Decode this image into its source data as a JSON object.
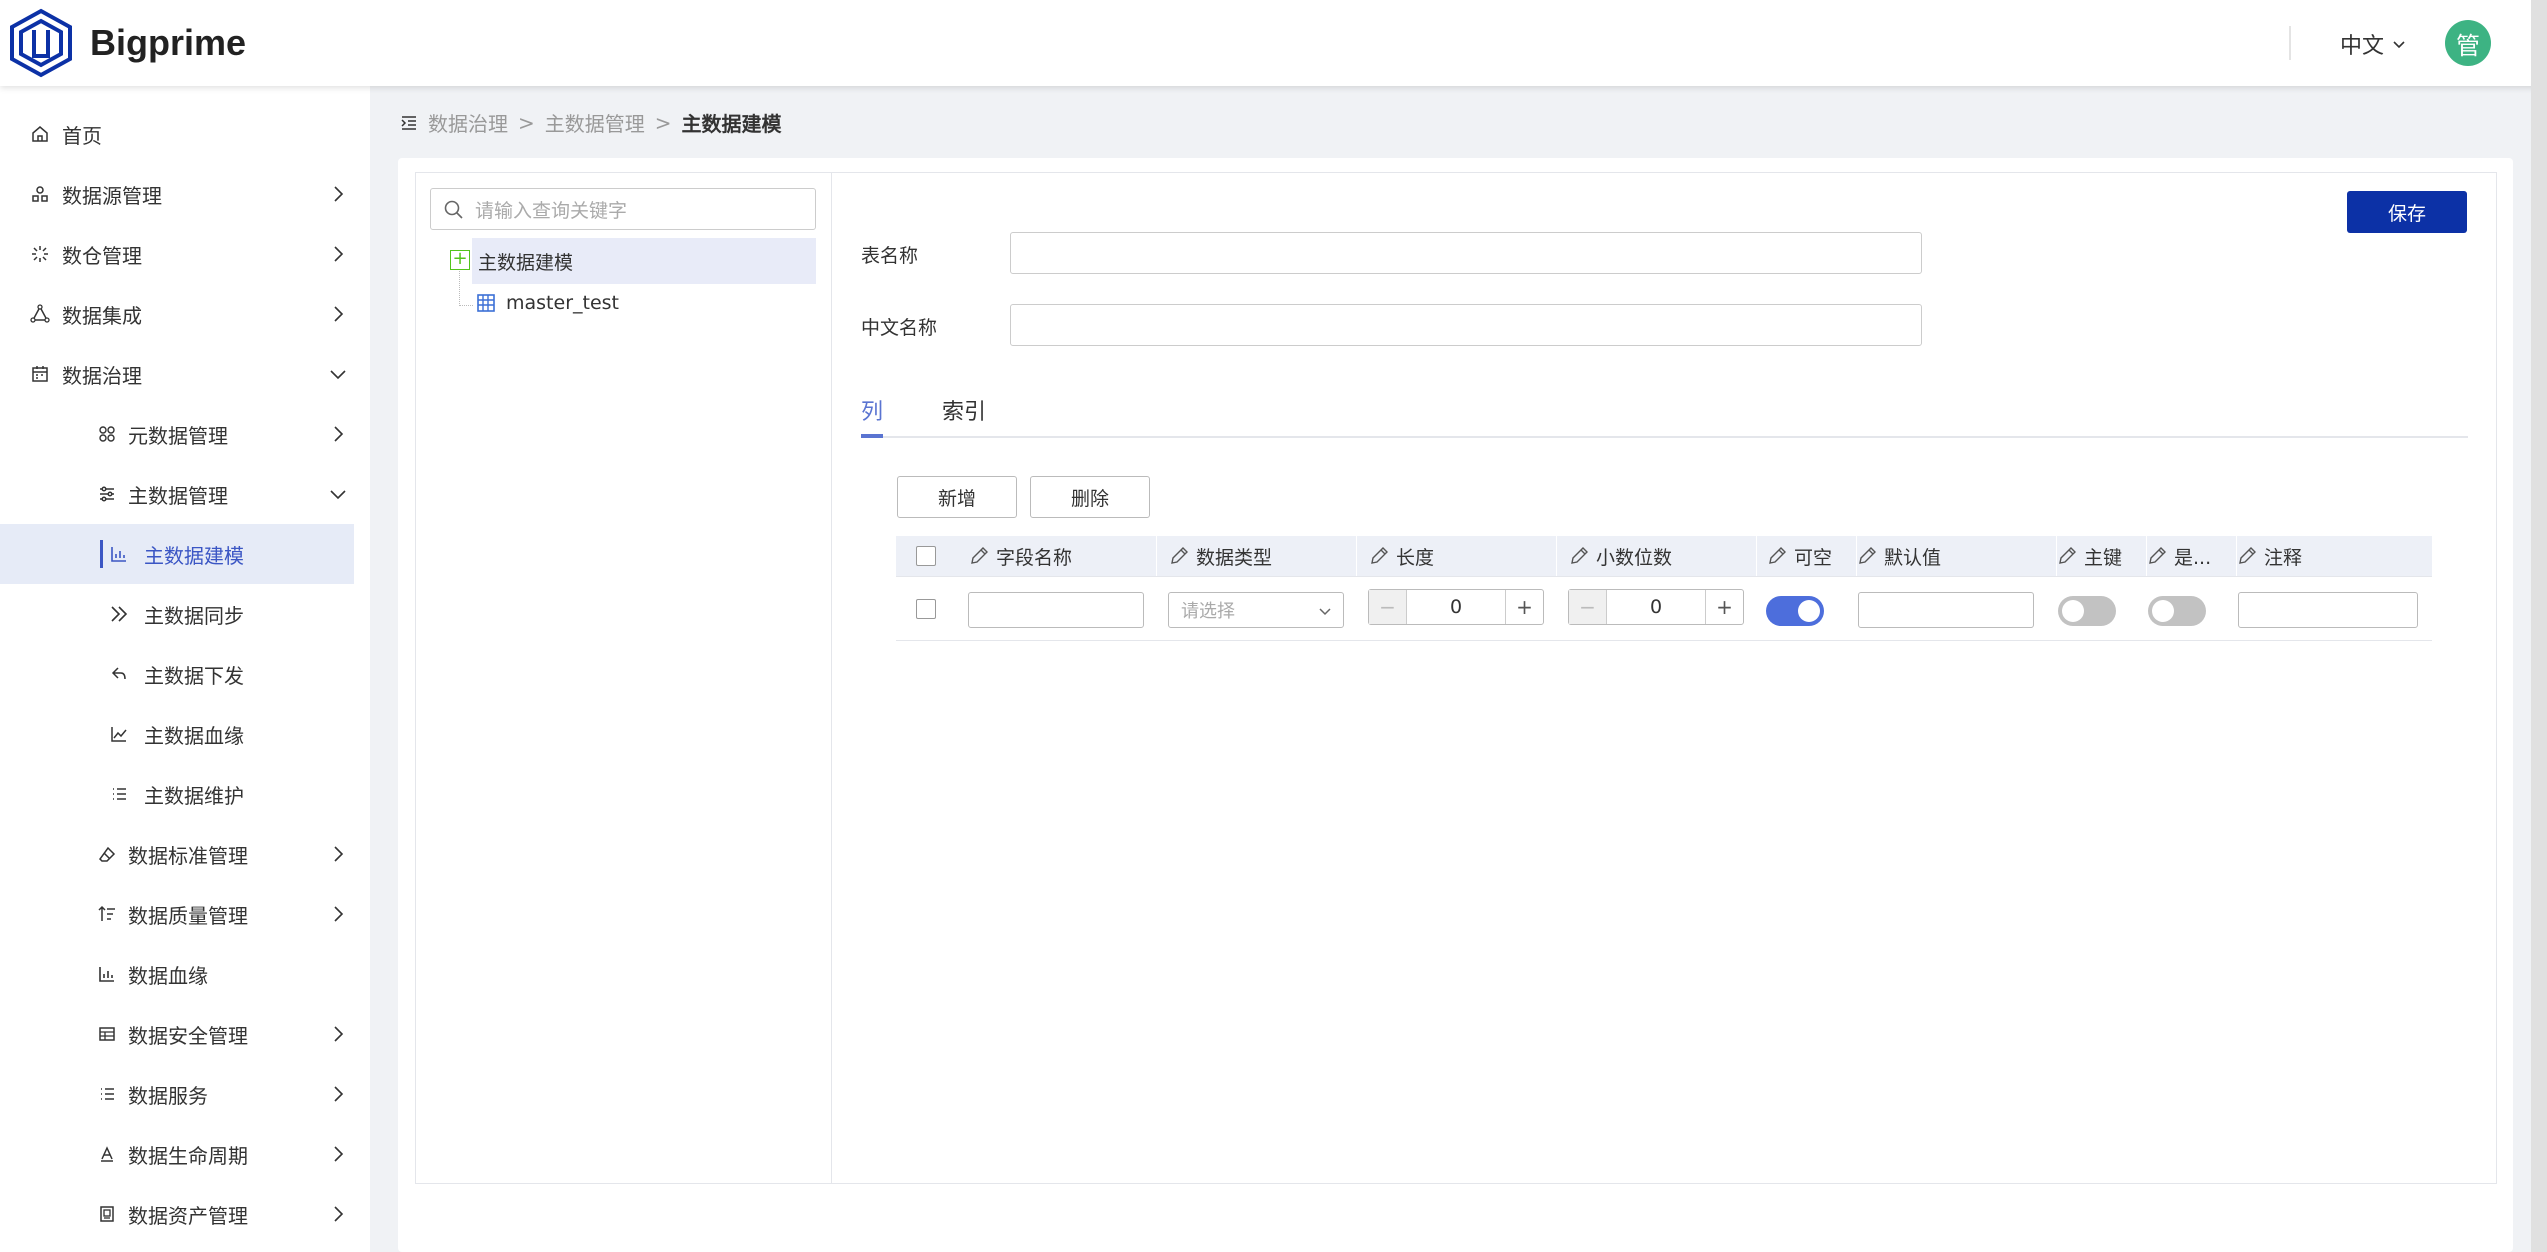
{
  "header": {
    "brand": "Bigprime",
    "language": "中文",
    "avatar_text": "管",
    "colors": {
      "brand_blue": "#0c31a6",
      "avatar": "#3db383",
      "accent": "#3b56c4"
    }
  },
  "sidebar": {
    "items": [
      {
        "label": "首页",
        "icon": "home-icon"
      },
      {
        "label": "数据源管理",
        "icon": "datasource-icon"
      },
      {
        "label": "数仓管理",
        "icon": "warehouse-icon"
      },
      {
        "label": "数据集成",
        "icon": "integration-icon"
      },
      {
        "label": "数据治理",
        "icon": "governance-icon"
      },
      {
        "label": "元数据管理",
        "icon": "metadata-icon"
      },
      {
        "label": "主数据管理",
        "icon": "sliders-icon"
      },
      {
        "label": "主数据建模",
        "icon": "bar-chart-icon"
      },
      {
        "label": "主数据同步",
        "icon": "double-chevron-icon"
      },
      {
        "label": "主数据下发",
        "icon": "reply-icon"
      },
      {
        "label": "主数据血缘",
        "icon": "line-chart-icon"
      },
      {
        "label": "主数据维护",
        "icon": "list-icon"
      },
      {
        "label": "数据标准管理",
        "icon": "eraser-icon"
      },
      {
        "label": "数据质量管理",
        "icon": "filter-list-icon"
      },
      {
        "label": "数据血缘",
        "icon": "bar-chart-icon"
      },
      {
        "label": "数据安全管理",
        "icon": "grid-icon"
      },
      {
        "label": "数据服务",
        "icon": "list-icon"
      },
      {
        "label": "数据生命周期",
        "icon": "lifecycle-icon"
      },
      {
        "label": "数据资产管理",
        "icon": "asset-icon"
      }
    ]
  },
  "breadcrumb": {
    "items": [
      "数据治理",
      "主数据管理"
    ],
    "current": "主数据建模"
  },
  "tree": {
    "search_placeholder": "请输入查询关键字",
    "root": "主数据建模",
    "child": "master_test"
  },
  "form": {
    "save_label": "保存",
    "table_name_label": "表名称",
    "table_name_value": "",
    "cn_name_label": "中文名称",
    "cn_name_value": ""
  },
  "tabs": {
    "columns": "列",
    "index": "索引",
    "active": "列"
  },
  "actions": {
    "add": "新增",
    "delete": "删除"
  },
  "table": {
    "headers": [
      "字段名称",
      "数据类型",
      "长度",
      "小数位数",
      "可空",
      "默认值",
      "主键",
      "是...",
      "注释"
    ],
    "row": {
      "type_placeholder": "请选择",
      "length": "0",
      "decimals": "0",
      "nullable": true,
      "primary_key": false,
      "is_flag": false
    }
  }
}
